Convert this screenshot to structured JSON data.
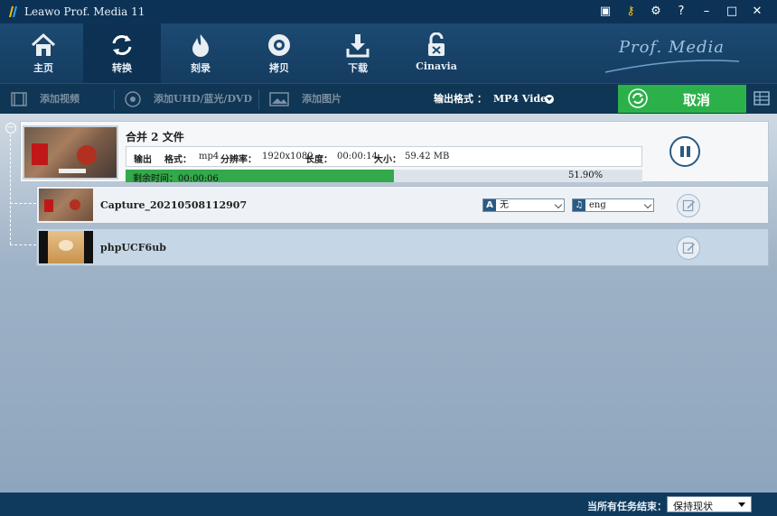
{
  "window": {
    "title": "Leawo Prof. Media 11",
    "controls": [
      "message-icon",
      "key-icon",
      "gear-icon",
      "help-icon",
      "minimize-icon",
      "maximize-icon",
      "close-icon"
    ]
  },
  "nav": {
    "items": [
      {
        "label": "主页",
        "icon": "home-icon"
      },
      {
        "label": "转换",
        "icon": "convert-icon",
        "active": true
      },
      {
        "label": "刻录",
        "icon": "burn-icon"
      },
      {
        "label": "拷贝",
        "icon": "disc-icon"
      },
      {
        "label": "下载",
        "icon": "download-icon"
      },
      {
        "label": "Cinavia",
        "icon": "unlock-icon"
      }
    ],
    "brand": "Prof. Media"
  },
  "toolbar": {
    "add_video": "添加视频",
    "add_uhd": "添加UHD/蓝光/DVD",
    "add_photo": "添加图片",
    "format_label": "输出格式 ：",
    "format_value": "MP4 Video",
    "cancel": "取消"
  },
  "merge": {
    "title": "合并 2 文件",
    "output": {
      "output_label": "输出",
      "format_label": "格式：",
      "format_value": "mp4",
      "resolution_label": "分辨率：",
      "resolution_value": "1920x1080",
      "length_label": "长度：",
      "length_value": "00:00:14",
      "size_label": "大小：",
      "size_value": "59.42 MB"
    },
    "remaining_label": "剩余时间：00:00:06",
    "progress_pct": "51.90%",
    "progress_fraction": 0.519
  },
  "files": [
    {
      "name": "Capture_20210508112907",
      "subtitle": "无",
      "audio": "eng"
    },
    {
      "name": "phpUCF6ub"
    }
  ],
  "status": {
    "label": "当所有任务结束：",
    "value": "保持现状"
  },
  "colors": {
    "accent_green": "#2cb14a",
    "nav_dark": "#0d3152"
  }
}
